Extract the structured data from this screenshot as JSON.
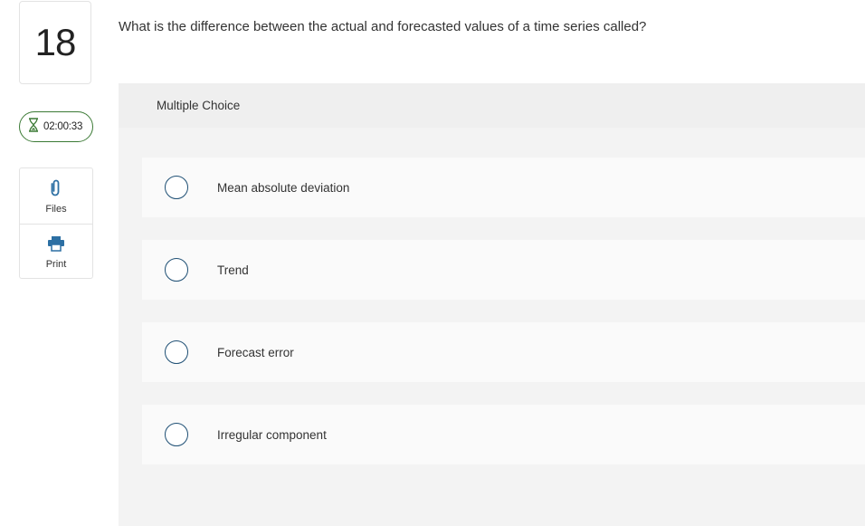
{
  "question": {
    "number": "18",
    "text": "What is the difference between the actual and forecasted values of a time series called?",
    "type_label": "Multiple Choice"
  },
  "timer": {
    "value": "02:00:33",
    "icon": "hourglass-icon"
  },
  "tools": [
    {
      "label": "Files",
      "icon": "paperclip-icon"
    },
    {
      "label": "Print",
      "icon": "printer-icon"
    }
  ],
  "options": [
    {
      "label": "Mean absolute deviation"
    },
    {
      "label": "Trend"
    },
    {
      "label": "Forecast error"
    },
    {
      "label": "Irregular component"
    }
  ],
  "colors": {
    "timer_border": "#3b7a35",
    "radio_border": "#1e4f74",
    "tool_icon": "#2c6fa3"
  }
}
